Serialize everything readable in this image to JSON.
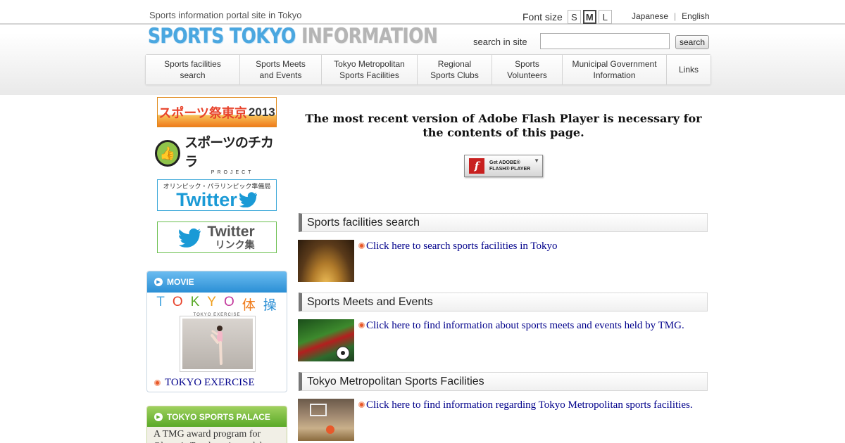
{
  "header": {
    "tagline": "Sports information portal site in Tokyo",
    "logo_main": "SPORTS TOKYO",
    "logo_sub": "INFORMATION",
    "font_size_label": "Font size",
    "font_sizes": [
      "S",
      "M",
      "L"
    ],
    "font_size_selected": "M",
    "languages": [
      "Japanese",
      "English"
    ],
    "search_label": "search in site",
    "search_value": "",
    "search_button": "search"
  },
  "nav": [
    "Sports facilities\nsearch",
    "Sports Meets\nand Events",
    "Tokyo Metropolitan\nSports Facilities",
    "Regional\nSports Clubs",
    "Sports\nVolunteers",
    "Municipal Government\nInformation",
    "Links"
  ],
  "sidebar": {
    "banner_matsuri": "スポーツ祭東京",
    "banner_matsuri_year": "2013",
    "banner_chikara": "スポーツのチカラ",
    "banner_chikara_sub": "PROJECT",
    "banner_twitter1_top": "オリンピック・パラリンピック準備局",
    "banner_twitter1_main": "Twitter",
    "banner_twitter2_main": "Twitter",
    "banner_twitter2_sub": "リンク集",
    "movie_heading": "MOVIE",
    "movie_title_chars": [
      "T",
      "O",
      "K",
      "Y",
      "O",
      "体",
      "操"
    ],
    "movie_subtitle": "TOKYO EXERCISE",
    "movie_link": "TOKYO EXERCISE",
    "palace_heading": "TOKYO SPORTS PALACE",
    "palace_text": "A TMG award program for Olympic/Paralympic medal"
  },
  "main": {
    "flash_message": "The most recent version of Adobe Flash Player is necessary for the contents of this page.",
    "flash_button_line1": "Get ADOBE®",
    "flash_button_line2": "FLASH® PLAYER",
    "sections": [
      {
        "title": "Sports facilities search",
        "link": "Click here to search sports facilities in Tokyo"
      },
      {
        "title": "Sports Meets and Events",
        "link": "Click here to find information about sports meets and events held by TMG."
      },
      {
        "title": "Tokyo Metropolitan Sports Facilities",
        "link": "Click here to find information regarding Tokyo Metropolitan sports facilities."
      }
    ]
  },
  "colors": {
    "link": "#00008b",
    "logo_blue": "#4aa7e0",
    "movie_blue": "#2b8fd5",
    "palace_green": "#5aa928",
    "flash_red": "#c8201f"
  },
  "icons": [
    "twitter-bird-icon",
    "play-circle-icon",
    "orange-bullet-icon",
    "flash-icon",
    "download-arrow-icon"
  ]
}
